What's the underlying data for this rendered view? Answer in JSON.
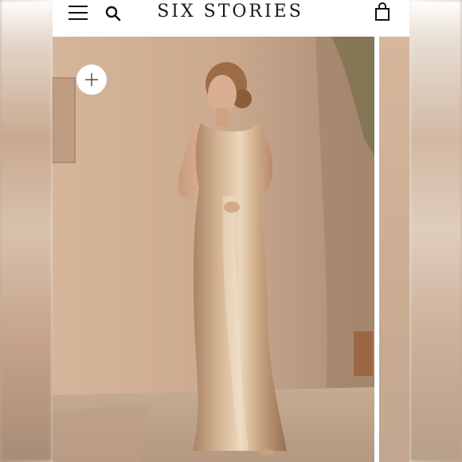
{
  "header": {
    "brand": "SIX STORIES",
    "icons": {
      "menu": "hamburger-menu-icon",
      "search": "search-icon",
      "bag": "shopping-bag-icon"
    }
  },
  "gallery": {
    "zoom_icon": "plus-icon",
    "image": "photo-of-woman-in-champagne-satin-gown"
  }
}
